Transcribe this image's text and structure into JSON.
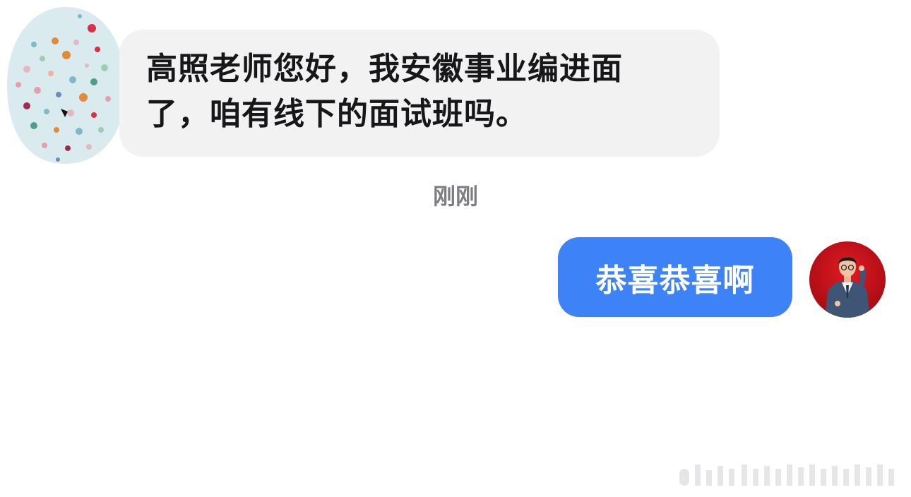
{
  "chat": {
    "incoming": {
      "line1": "高照老师您好，我安徽事业编进面",
      "line2": "了，咱有线下的面试班吗。"
    },
    "timestamp": "刚刚",
    "outgoing": {
      "text": "恭喜恭喜啊"
    }
  },
  "colors": {
    "incoming_bubble": "#f2f2f3",
    "outgoing_bubble": "#3d82f6",
    "timestamp_text": "#7d7d82",
    "avatar_right_bg": "#c8101a"
  }
}
